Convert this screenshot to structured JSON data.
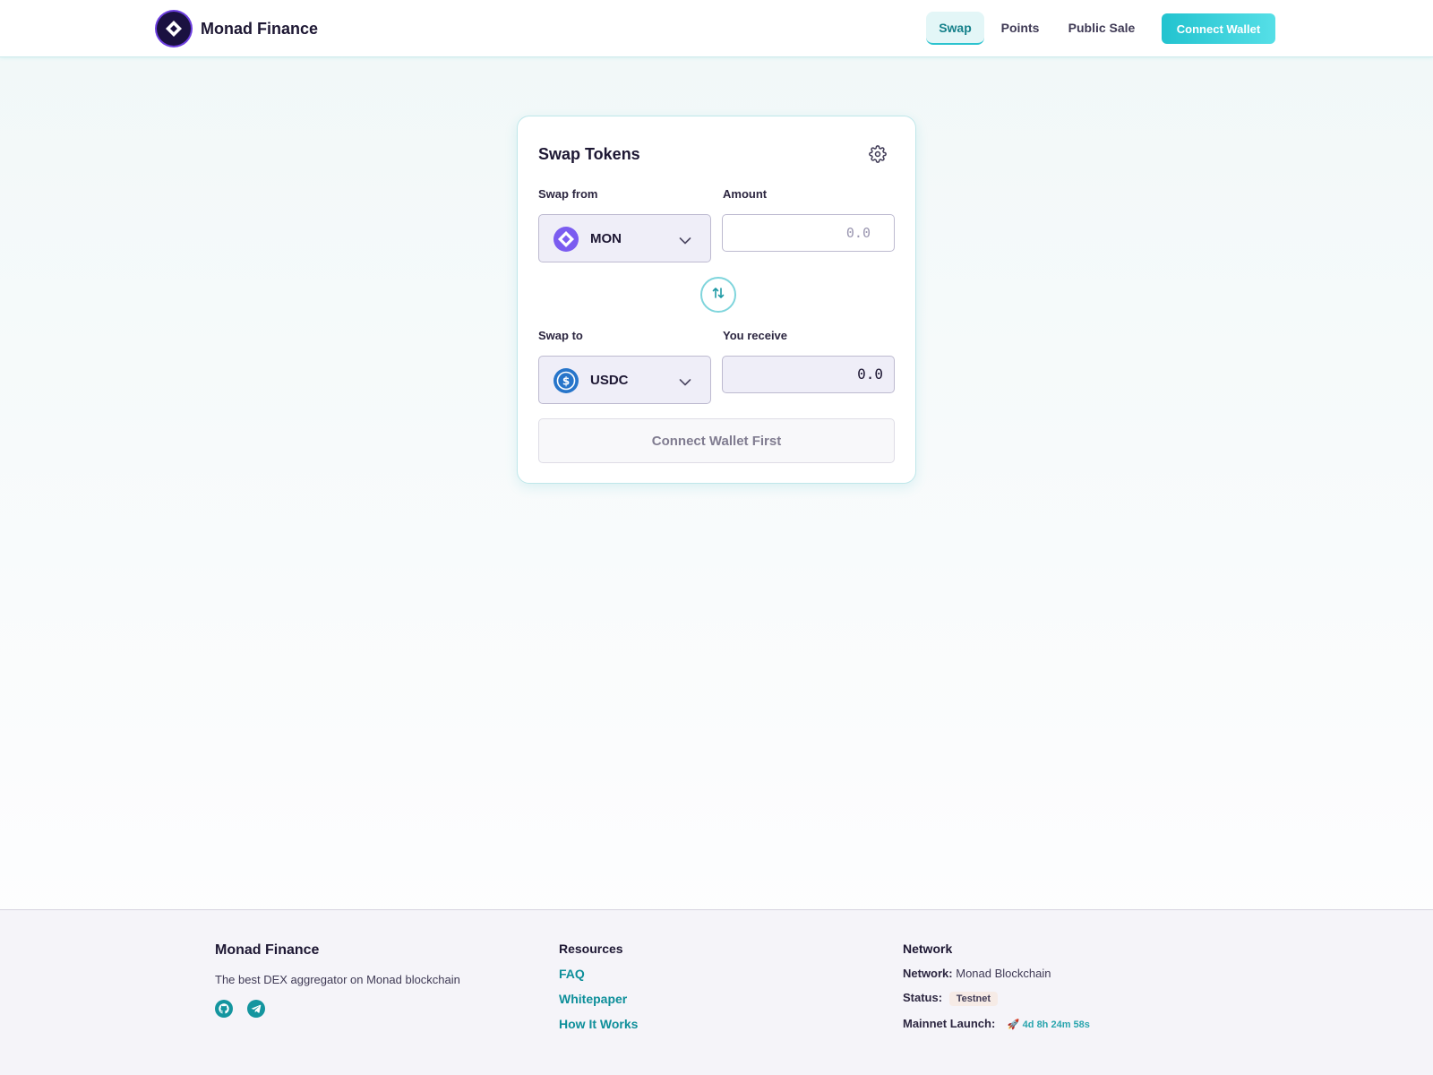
{
  "header": {
    "brand": "Monad Finance",
    "nav": [
      {
        "label": "Swap",
        "active": true
      },
      {
        "label": "Points",
        "active": false
      },
      {
        "label": "Public Sale",
        "active": false
      }
    ],
    "connect_label": "Connect Wallet"
  },
  "swap_card": {
    "title": "Swap Tokens",
    "from_label": "Swap from",
    "amount_label": "Amount",
    "from_token": "MON",
    "amount_placeholder": "0.0",
    "to_label": "Swap to",
    "receive_label": "You receive",
    "to_token": "USDC",
    "receive_value": "0.0",
    "submit_label": "Connect Wallet First",
    "icons": {
      "settings": "gear-icon",
      "swap": "swap-direction-icon",
      "from_token": "mon-token-icon",
      "to_token": "usdc-token-icon"
    }
  },
  "footer": {
    "brand": "Monad Finance",
    "tagline": "The best DEX aggregator on Monad blockchain",
    "resources_heading": "Resources",
    "resources": [
      "FAQ",
      "Whitepaper",
      "How It Works"
    ],
    "network_heading": "Network",
    "network_key": "Network:",
    "network_value": "Monad Blockchain",
    "status_key": "Status:",
    "status_value": "Testnet",
    "launch_key": "Mainnet Launch:",
    "launch_icon": "🚀",
    "launch_value": "4d 8h 24m 58s",
    "social_icons": [
      "github-icon",
      "telegram-icon"
    ]
  },
  "colors": {
    "accent": "#22c3cf",
    "link": "#0e8f9a",
    "text": "#1d1733",
    "mon_token": "#7b5cf0",
    "usdc_token": "#2775ca"
  }
}
